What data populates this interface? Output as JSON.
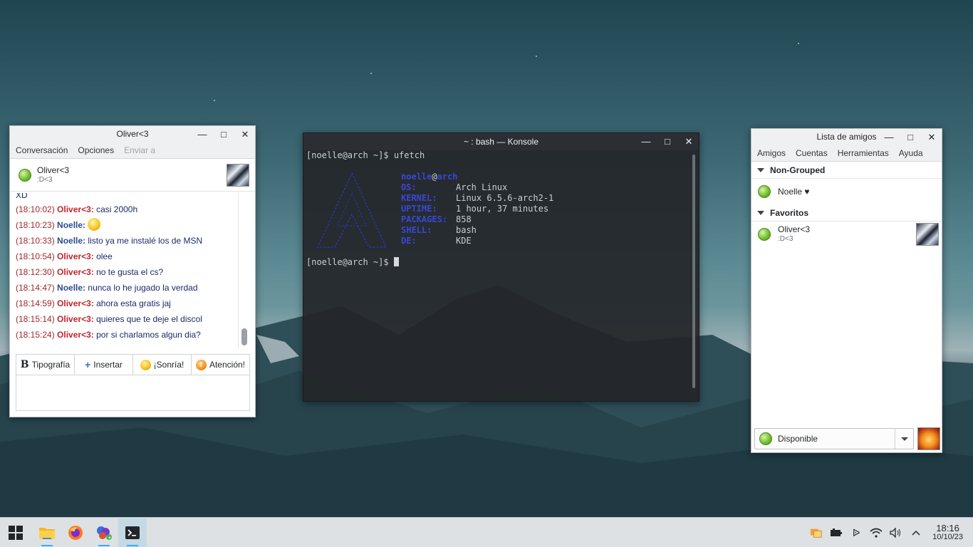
{
  "chat_window": {
    "title": "Oliver<3",
    "menu": [
      "Conversación",
      "Opciones",
      "Enviar a"
    ],
    "contact_name": "Oliver<3",
    "contact_status_msg": ":D<3",
    "partial_top": "XD",
    "messages": [
      {
        "time": "(18:10:02)",
        "who": "Oliver<3:",
        "text": "casi 2000h"
      },
      {
        "time": "(18:10:23)",
        "who": "Noelle:",
        "text": ""
      },
      {
        "time": "(18:10:33)",
        "who": "Noelle:",
        "text": "listo ya me instalé los de MSN"
      },
      {
        "time": "(18:10:54)",
        "who": "Oliver<3:",
        "text": "olee"
      },
      {
        "time": "(18:12:30)",
        "who": "Oliver<3:",
        "text": "no te gusta el cs?"
      },
      {
        "time": "(18:14:47)",
        "who": "Noelle:",
        "text": "nunca lo he jugado la verdad"
      },
      {
        "time": "(18:14:59)",
        "who": "Oliver<3:",
        "text": "ahora esta gratis jaj"
      },
      {
        "time": "(18:15:14)",
        "who": "Oliver<3:",
        "text": "quieres que te deje el discol"
      },
      {
        "time": "(18:15:24)",
        "who": "Oliver<3:",
        "text": "por si charlamos algun dia?"
      }
    ],
    "toolbar": {
      "font": "Tipografía",
      "insert": "Insertar",
      "smile": "¡Sonría!",
      "attention": "Atención!"
    }
  },
  "konsole": {
    "title": "~ : bash — Konsole",
    "prompt1": "[noelle@arch ~]$ ufetch",
    "user": "noelle",
    "at": "@",
    "host": "arch",
    "info": [
      {
        "label": "OS:",
        "value": "Arch Linux"
      },
      {
        "label": "KERNEL:",
        "value": "Linux 6.5.6-arch2-1"
      },
      {
        "label": "UPTIME:",
        "value": "1 hour, 37 minutes"
      },
      {
        "label": "PACKAGES:",
        "value": "858"
      },
      {
        "label": "SHELL:",
        "value": "bash"
      },
      {
        "label": "DE:",
        "value": "KDE"
      }
    ],
    "prompt2": "[noelle@arch ~]$ "
  },
  "contact_list": {
    "title": "Lista de amigos",
    "menu": [
      "Amigos",
      "Cuentas",
      "Herramientas",
      "Ayuda"
    ],
    "group1": "Non-Grouped",
    "contact1": "Noelle ♥",
    "group2": "Favoritos",
    "contact2_name": "Oliver<3",
    "contact2_status": ":D<3",
    "status": "Disponible"
  },
  "taskbar": {
    "time": "18:16",
    "date": "10/10/23"
  }
}
